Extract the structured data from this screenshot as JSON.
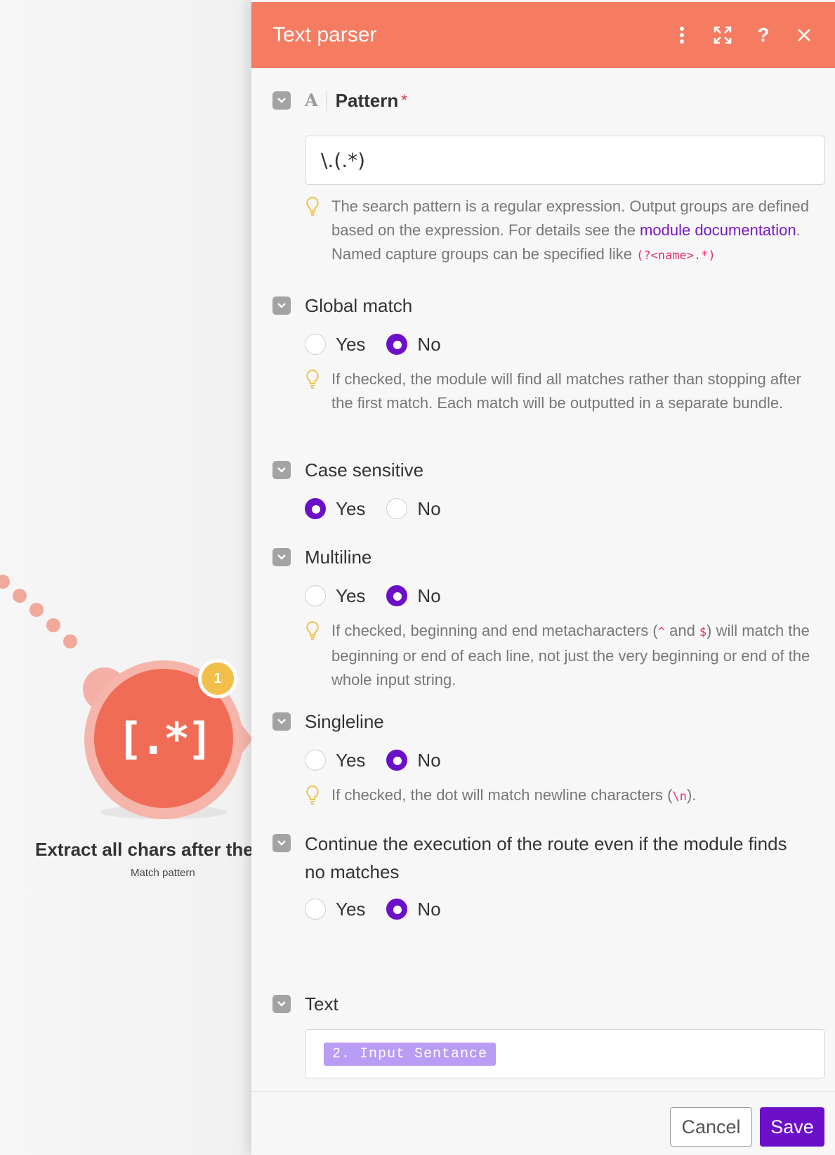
{
  "colors": {
    "header_bg": "#f57b61",
    "accent_purple": "#6c0fc8",
    "module_red": "#f16c56",
    "badge_yellow": "#f2c04a",
    "link_purple": "#7b17c9",
    "required_red": "#e0314b"
  },
  "canvas": {
    "module_icon": "[.*]",
    "badge_count": "1",
    "module_title": "Extract all chars after the",
    "module_subtitle": "Match pattern"
  },
  "panel": {
    "title": "Text parser",
    "icons": [
      "more-vertical-icon",
      "expand-icon",
      "help-icon",
      "close-icon"
    ],
    "help_glyph": "?"
  },
  "pattern": {
    "type_glyph": "A",
    "label": "Pattern",
    "required_mark": "*",
    "value": "\\.(.*)",
    "hint_part1": "The search pattern is a regular expression. Output groups are defined based on the expression. For details see the ",
    "hint_link": "module documentation",
    "hint_part2": ".",
    "hint_line2": "Named capture groups can be specified like ",
    "hint_code": "(?<name>.*)"
  },
  "global_match": {
    "label": "Global match",
    "yes": "Yes",
    "no": "No",
    "selected": "No",
    "hint": "If checked, the module will find all matches rather than stopping after the first match. Each match will be outputted in a separate bundle."
  },
  "case_sensitive": {
    "label": "Case sensitive",
    "yes": "Yes",
    "no": "No",
    "selected": "Yes"
  },
  "multiline": {
    "label": "Multiline",
    "yes": "Yes",
    "no": "No",
    "selected": "No",
    "hint_a": "If checked, beginning and end metacharacters (",
    "hint_caret": "^",
    "hint_and": " and ",
    "hint_dollar": "$",
    "hint_b": ") will match the beginning or end of each line, not just the very beginning or end of the whole input string."
  },
  "singleline": {
    "label": "Singleline",
    "yes": "Yes",
    "no": "No",
    "selected": "No",
    "hint_a": "If checked, the dot will match newline characters (",
    "hint_code": "\\n",
    "hint_b": ")."
  },
  "continue_execution": {
    "label": "Continue the execution of the route even if the module finds no matches",
    "yes": "Yes",
    "no": "No",
    "selected": "No"
  },
  "text": {
    "label": "Text",
    "pill": "2. Input Sentance"
  },
  "footer": {
    "cancel": "Cancel",
    "save": "Save"
  }
}
